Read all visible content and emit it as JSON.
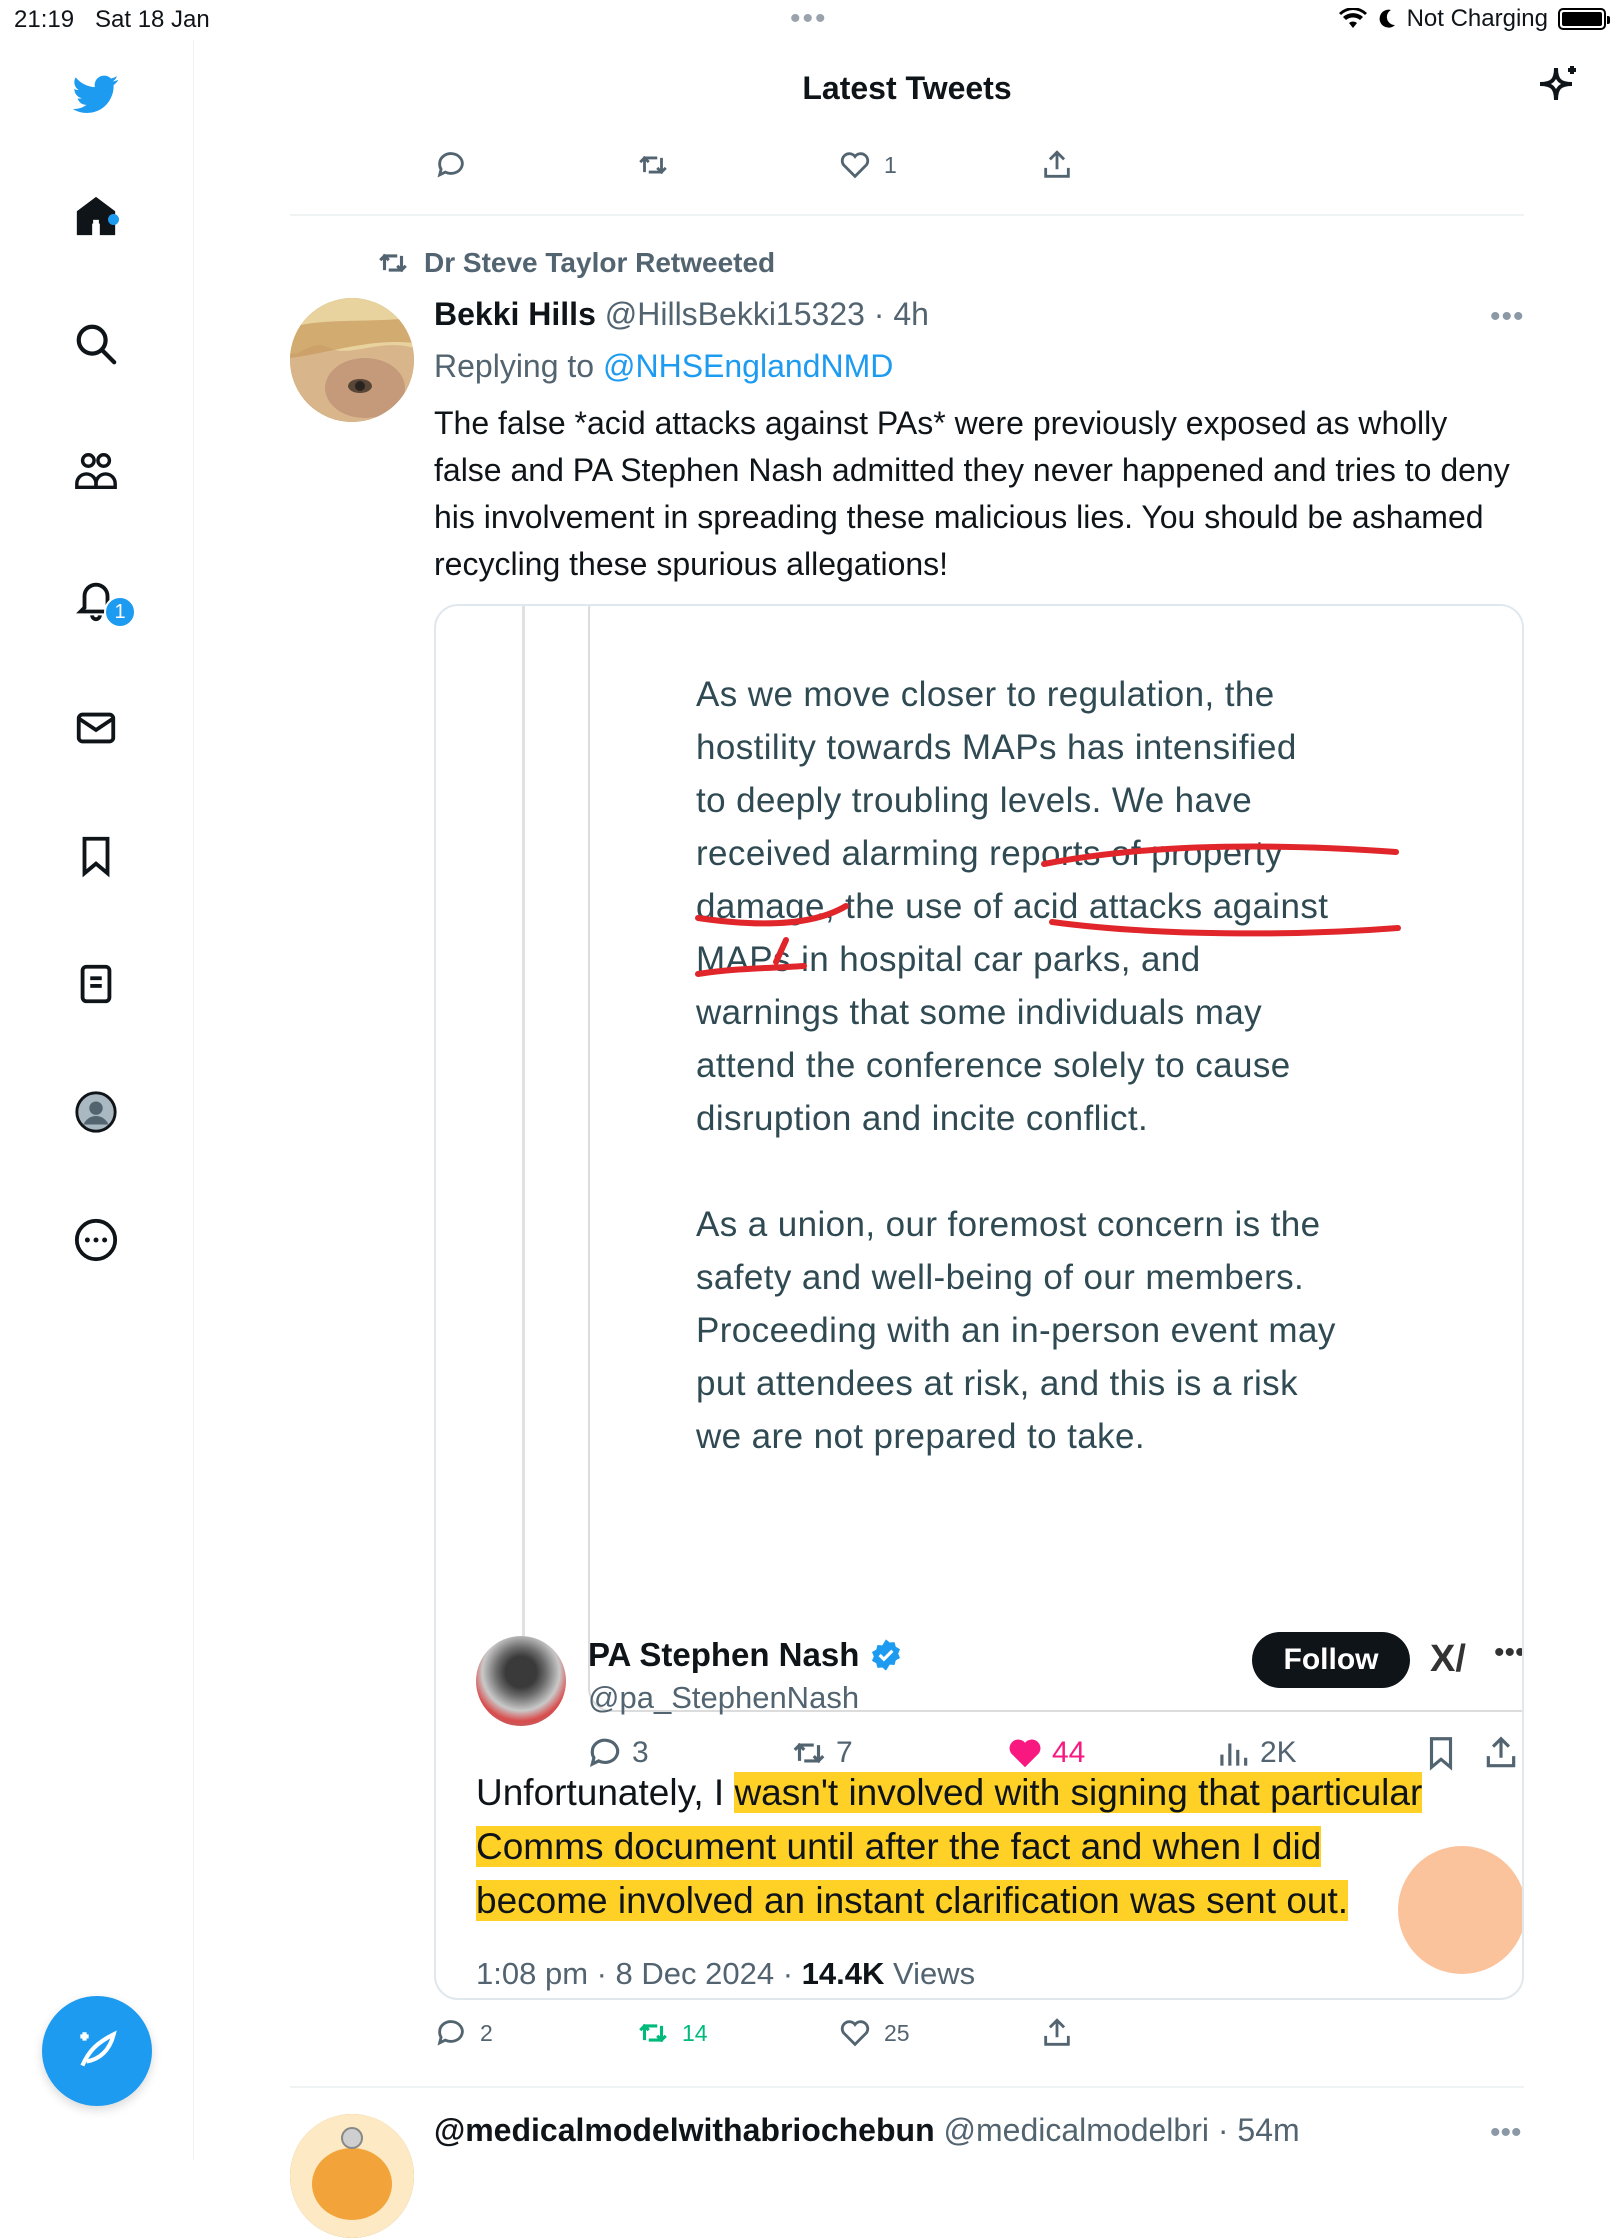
{
  "status_bar": {
    "time": "21:19",
    "date": "Sat 18 Jan",
    "charging": "Not Charging"
  },
  "header": {
    "title": "Latest Tweets"
  },
  "sidebar": {
    "items": [
      {
        "icon": "home-icon"
      },
      {
        "icon": "search-icon"
      },
      {
        "icon": "communities-icon"
      },
      {
        "icon": "notifications-icon",
        "badge": "1"
      },
      {
        "icon": "messages-icon"
      },
      {
        "icon": "bookmarks-icon"
      },
      {
        "icon": "lists-icon"
      },
      {
        "icon": "profile-icon"
      },
      {
        "icon": "more-icon"
      }
    ]
  },
  "prev_tweet_actions": {
    "replies": "",
    "retweets": "",
    "likes": "1"
  },
  "tweet": {
    "retweeted_by": "Dr Steve Taylor Retweeted",
    "name": "Bekki Hills",
    "handle": "@HillsBekki15323",
    "time": "· 4h",
    "replying_prefix": "Replying to",
    "replying_to": "@NHSEnglandNMD",
    "text": "The false *acid attacks against PAs* were previously exposed as wholly false and PA Stephen Nash admitted they never happened and tries to deny his involvement in spreading these malicious lies. You should be ashamed recycling these spurious allegations!",
    "image": {
      "doc_paragraph_1_lines": [
        "As we move closer to regulation, the",
        "hostility towards MAPs has intensified",
        "to deeply troubling levels. We have",
        "received alarming reports of property",
        "damage, the use of acid attacks against",
        "MAPs in hospital car parks, and",
        "warnings that some individuals may",
        "attend the conference solely to cause",
        "disruption and incite conflict."
      ],
      "doc_paragraph_2_lines": [
        "As a union, our foremost concern is the",
        "safety and well-being of our members.",
        "Proceeding with an in-person event may",
        "put attendees at risk, and this is a risk",
        "we are not prepared to take."
      ],
      "inner_actions": {
        "replies": "3",
        "retweets": "7",
        "likes": "44",
        "views": "2K"
      },
      "quoted": {
        "name": "PA Stephen Nash",
        "handle": "@pa_StephenNash",
        "follow_label": "Follow",
        "text_plain": "Unfortunately, I ",
        "text_highlight_1": "wasn't involved with signing that particular",
        "text_highlight_2": "Comms document until after the fact and when I did",
        "text_highlight_3": "become involved an instant clarification was sent out.",
        "time": "1:08 pm · 8 Dec 2024 · ",
        "views_count": "14.4K",
        "views_label": " Views"
      }
    },
    "actions": {
      "replies": "2",
      "retweets": "14",
      "likes": "25"
    }
  },
  "next_tweet": {
    "name": "@medicalmodelwithabriochebun",
    "handle": "@medicalmodelbri",
    "time": "· 54m"
  },
  "colors": {
    "accent": "#1d9bf0",
    "like": "#f91880",
    "retweet_active": "#00ba7c",
    "highlight": "#ffc800",
    "underline": "#e0262a"
  }
}
